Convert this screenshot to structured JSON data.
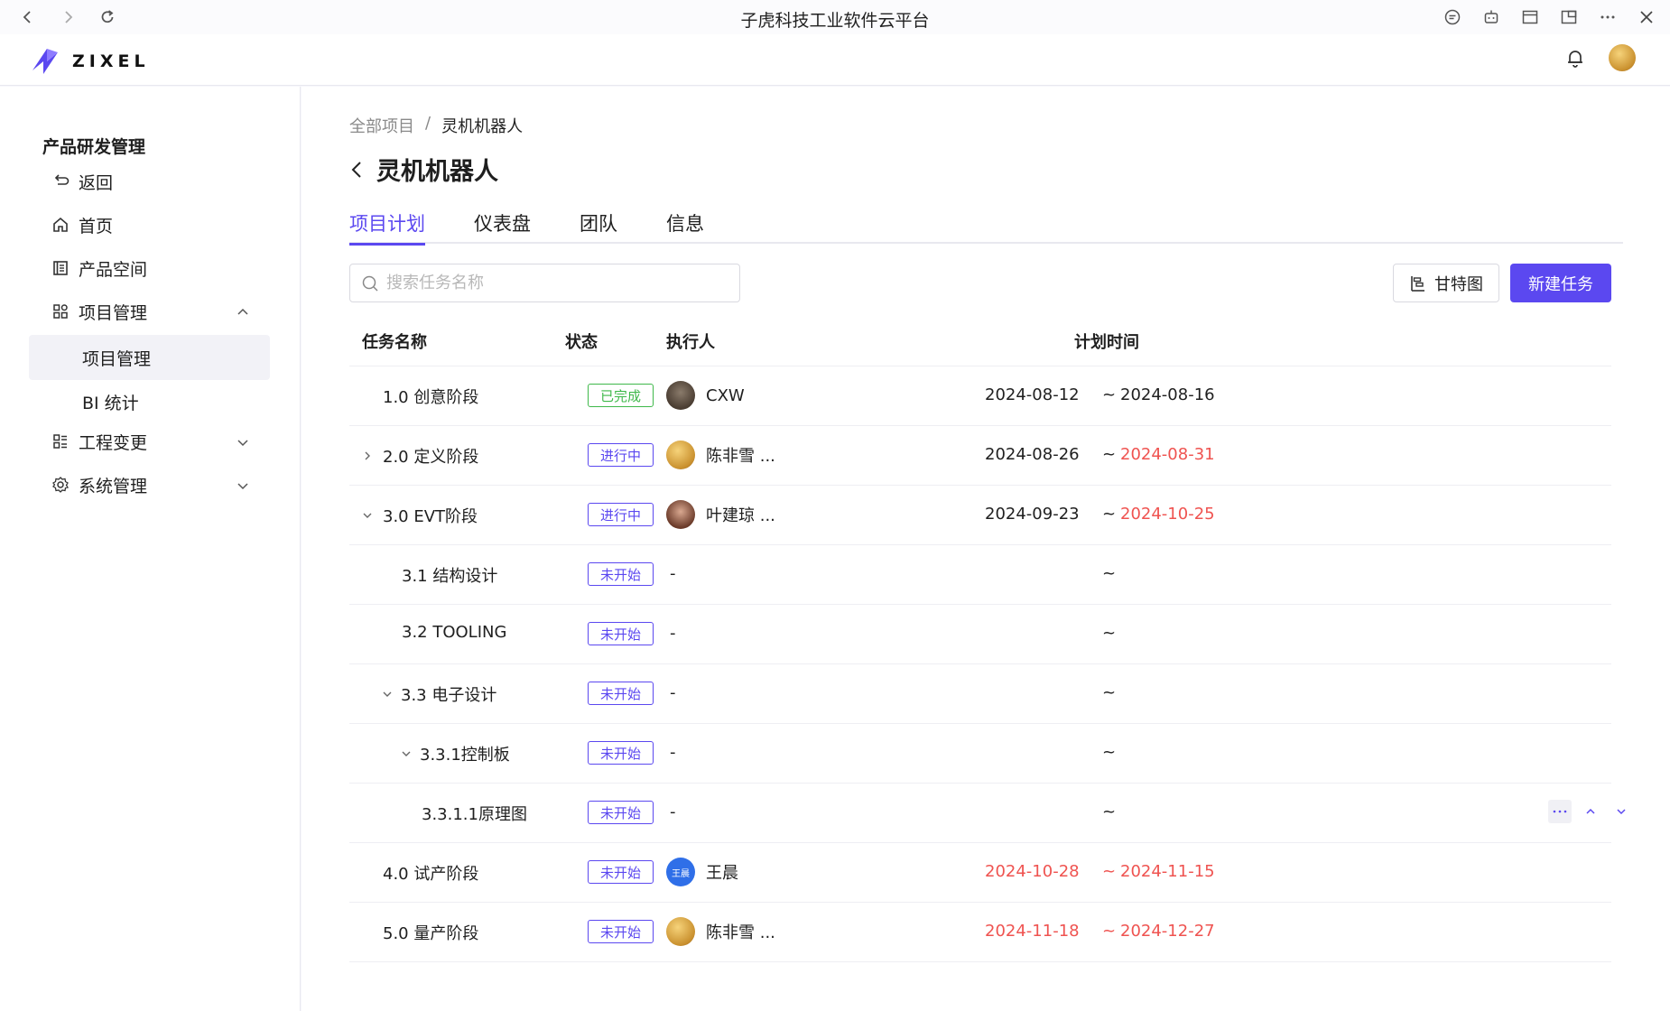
{
  "window": {
    "title": "子虎科技工业软件云平台"
  },
  "brand": {
    "name": "ZIXEL",
    "accent": "#5b48f0"
  },
  "sidebar": {
    "title": "产品研发管理",
    "items": [
      {
        "label": "返回",
        "icon": "undo-icon"
      },
      {
        "label": "首页",
        "icon": "home-icon"
      },
      {
        "label": "产品空间",
        "icon": "list-icon"
      },
      {
        "label": "项目管理",
        "icon": "grid-icon",
        "expanded": true
      },
      {
        "label": "项目管理",
        "sub": true,
        "active": true
      },
      {
        "label": "BI 统计",
        "sub": true
      },
      {
        "label": "工程变更",
        "icon": "changes-icon",
        "expanded": false
      },
      {
        "label": "系统管理",
        "icon": "gear-icon",
        "expanded": false
      }
    ]
  },
  "breadcrumb": {
    "root": "全部项目",
    "sep": "/",
    "current": "灵机机器人"
  },
  "page": {
    "title": "灵机机器人"
  },
  "tabs": [
    "项目计划",
    "仪表盘",
    "团队",
    "信息"
  ],
  "search": {
    "placeholder": "搜索任务名称"
  },
  "toolbar": {
    "gantt_label": "甘特图",
    "new_label": "新建任务"
  },
  "table": {
    "headers": {
      "name": "任务名称",
      "status": "状态",
      "owner": "执行人",
      "time": "计划时间"
    },
    "rows": [
      {
        "name": "1.0 创意阶段",
        "status": "已完成",
        "owner": "CXW",
        "start": "2024-08-12",
        "sep": "~",
        "end": "2024-08-16"
      },
      {
        "name": "2.0 定义阶段",
        "status": "进行中",
        "owner": "陈非雪 ...",
        "start": "2024-08-26",
        "sep": "~",
        "end": "2024-08-31"
      },
      {
        "name": "3.0 EVT阶段",
        "status": "进行中",
        "owner": "叶建琼 ...",
        "start": "2024-09-23",
        "sep": "~",
        "end": "2024-10-25"
      },
      {
        "name": "3.1 结构设计",
        "status": "未开始",
        "owner": "-",
        "sep": "~"
      },
      {
        "name": "3.2 TOOLING",
        "status": "未开始",
        "owner": "-",
        "sep": "~"
      },
      {
        "name": "3.3 电子设计",
        "status": "未开始",
        "owner": "-",
        "sep": "~"
      },
      {
        "name": "3.3.1控制板",
        "status": "未开始",
        "owner": "-",
        "sep": "~"
      },
      {
        "name": "3.3.1.1原理图",
        "status": "未开始",
        "owner": "-",
        "sep": "~"
      },
      {
        "name": "4.0 试产阶段",
        "status": "未开始",
        "owner": "王晨",
        "owner_avatar_text": "王晨",
        "start": "2024-10-28",
        "sep": "~",
        "end": "2024-11-15"
      },
      {
        "name": "5.0 量产阶段",
        "status": "未开始",
        "owner": "陈非雪 ...",
        "start": "2024-11-18",
        "sep": "~",
        "end": "2024-12-27"
      }
    ]
  }
}
